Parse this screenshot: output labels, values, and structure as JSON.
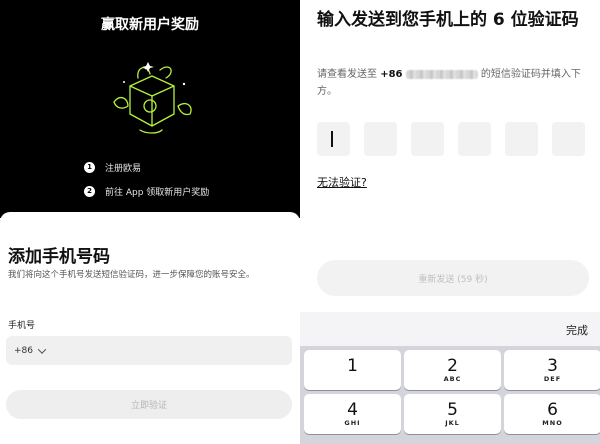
{
  "left": {
    "promo": {
      "title": "赢取新用户奖励",
      "steps": [
        {
          "num": "1",
          "label": "注册欧易"
        },
        {
          "num": "2",
          "label": "前往 App 领取新用户奖励"
        }
      ]
    },
    "sheet": {
      "title": "添加手机号码",
      "description": "我们将向这个手机号发送短信验证码，进一步保障您的账号安全。",
      "phone_label": "手机号",
      "country_code": "+86",
      "verify_button": "立即验证"
    }
  },
  "right": {
    "title": "输入发送到您手机上的 6 位验证码",
    "desc_prefix": "请查看发送至",
    "country_code": "+86",
    "desc_suffix": "的短信验证码并填入下方。",
    "code_digits": [
      "",
      "",
      "",
      "",
      "",
      ""
    ],
    "cant_verify": "无法验证?",
    "resend_button": "重新发送 (59 秒)",
    "keyboard": {
      "done": "完成",
      "keys": [
        {
          "digit": "1",
          "letters": ""
        },
        {
          "digit": "2",
          "letters": "ABC"
        },
        {
          "digit": "3",
          "letters": "DEF"
        },
        {
          "digit": "4",
          "letters": "GHI"
        },
        {
          "digit": "5",
          "letters": "JKL"
        },
        {
          "digit": "6",
          "letters": "MNO"
        }
      ]
    }
  },
  "colors": {
    "promo_bg": "#000000",
    "accent_green": "#b6f23a",
    "field_bg": "#f0f0f0",
    "keyboard_bg": "#d3d5db"
  },
  "icons": [
    "gift-box-illustration",
    "chevron-down-icon",
    "text-cursor"
  ]
}
